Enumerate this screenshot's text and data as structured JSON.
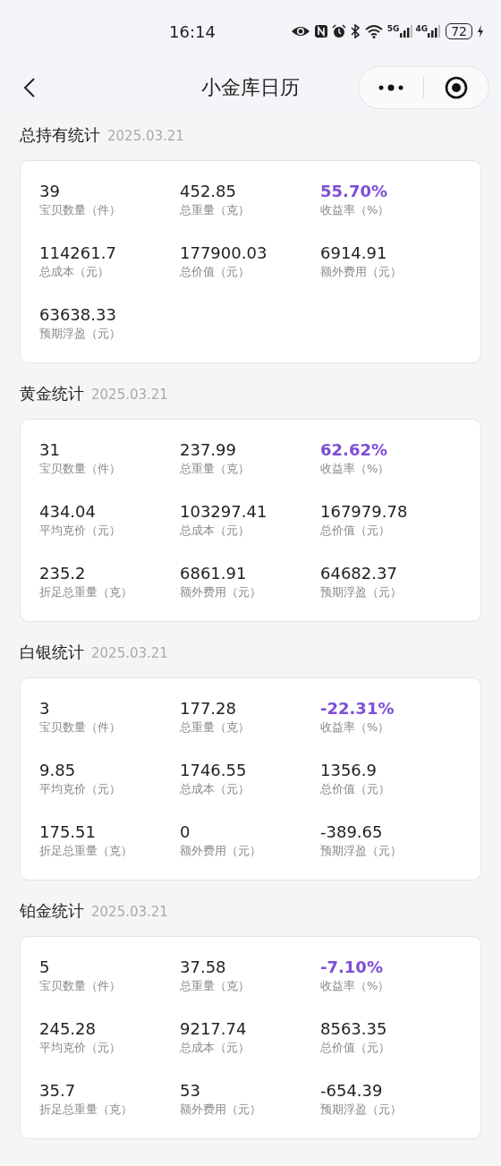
{
  "status_bar": {
    "time": "16:14",
    "network_5g": "5G",
    "network_4g": "4G",
    "battery": "72"
  },
  "nav": {
    "title": "小金库日历"
  },
  "sections": [
    {
      "title": "总持有统计",
      "date": "2025.03.21",
      "stats": [
        {
          "value": "39",
          "label": "宝贝数量（件）",
          "emphasized": false
        },
        {
          "value": "452.85",
          "label": "总重量（克）",
          "emphasized": false
        },
        {
          "value": "55.70%",
          "label": "收益率（%）",
          "emphasized": true
        },
        {
          "value": "114261.7",
          "label": "总成本（元）",
          "emphasized": false
        },
        {
          "value": "177900.03",
          "label": "总价值（元）",
          "emphasized": false
        },
        {
          "value": "6914.91",
          "label": "额外费用（元）",
          "emphasized": false
        },
        {
          "value": "63638.33",
          "label": "预期浮盈（元）",
          "emphasized": false
        }
      ]
    },
    {
      "title": "黄金统计",
      "date": "2025.03.21",
      "stats": [
        {
          "value": "31",
          "label": "宝贝数量（件）",
          "emphasized": false
        },
        {
          "value": "237.99",
          "label": "总重量（克）",
          "emphasized": false
        },
        {
          "value": "62.62%",
          "label": "收益率（%）",
          "emphasized": true
        },
        {
          "value": "434.04",
          "label": "平均克价（元）",
          "emphasized": false
        },
        {
          "value": "103297.41",
          "label": "总成本（元）",
          "emphasized": false
        },
        {
          "value": "167979.78",
          "label": "总价值（元）",
          "emphasized": false
        },
        {
          "value": "235.2",
          "label": "折足总重量（克）",
          "emphasized": false
        },
        {
          "value": "6861.91",
          "label": "额外费用（元）",
          "emphasized": false
        },
        {
          "value": "64682.37",
          "label": "预期浮盈（元）",
          "emphasized": false
        }
      ]
    },
    {
      "title": "白银统计",
      "date": "2025.03.21",
      "stats": [
        {
          "value": "3",
          "label": "宝贝数量（件）",
          "emphasized": false
        },
        {
          "value": "177.28",
          "label": "总重量（克）",
          "emphasized": false
        },
        {
          "value": "-22.31%",
          "label": "收益率（%）",
          "emphasized": true
        },
        {
          "value": "9.85",
          "label": "平均克价（元）",
          "emphasized": false
        },
        {
          "value": "1746.55",
          "label": "总成本（元）",
          "emphasized": false
        },
        {
          "value": "1356.9",
          "label": "总价值（元）",
          "emphasized": false
        },
        {
          "value": "175.51",
          "label": "折足总重量（克）",
          "emphasized": false
        },
        {
          "value": "0",
          "label": "额外费用（元）",
          "emphasized": false
        },
        {
          "value": "-389.65",
          "label": "预期浮盈（元）",
          "emphasized": false
        }
      ]
    },
    {
      "title": "铂金统计",
      "date": "2025.03.21",
      "stats": [
        {
          "value": "5",
          "label": "宝贝数量（件）",
          "emphasized": false
        },
        {
          "value": "37.58",
          "label": "总重量（克）",
          "emphasized": false
        },
        {
          "value": "-7.10%",
          "label": "收益率（%）",
          "emphasized": true
        },
        {
          "value": "245.28",
          "label": "平均克价（元）",
          "emphasized": false
        },
        {
          "value": "9217.74",
          "label": "总成本（元）",
          "emphasized": false
        },
        {
          "value": "8563.35",
          "label": "总价值（元）",
          "emphasized": false
        },
        {
          "value": "35.7",
          "label": "折足总重量（克）",
          "emphasized": false
        },
        {
          "value": "53",
          "label": "额外费用（元）",
          "emphasized": false
        },
        {
          "value": "-654.39",
          "label": "预期浮盈（元）",
          "emphasized": false
        }
      ]
    }
  ]
}
